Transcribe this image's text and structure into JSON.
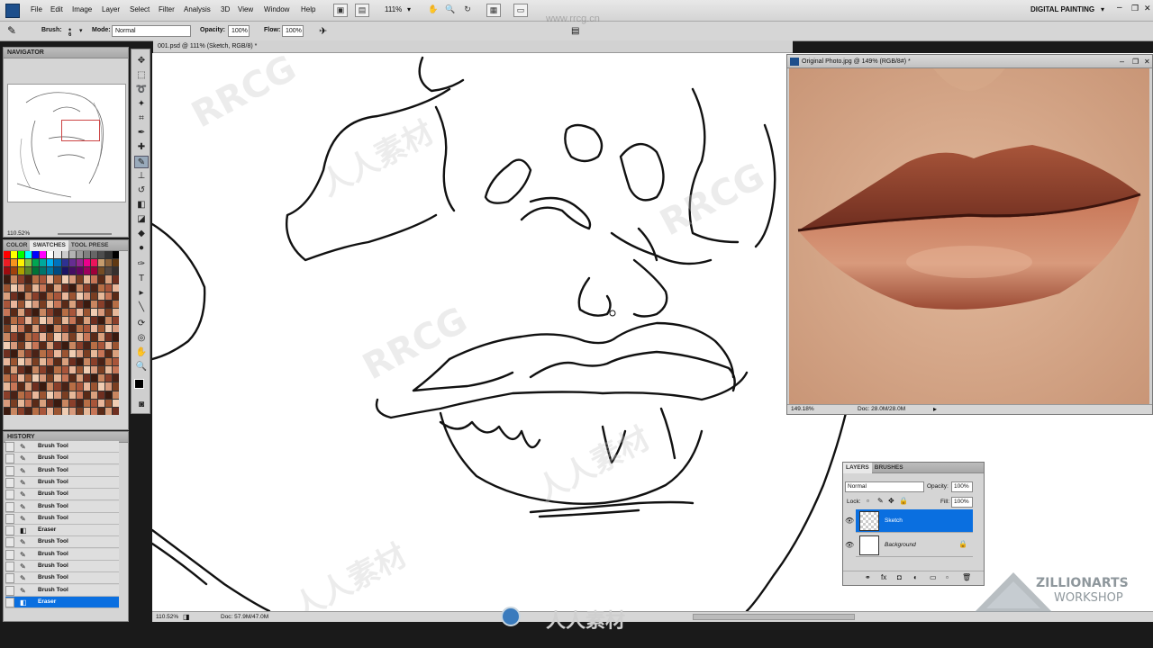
{
  "menubar": {
    "items": [
      "File",
      "Edit",
      "Image",
      "Layer",
      "Select",
      "Filter",
      "Analysis",
      "3D",
      "View",
      "Window",
      "Help"
    ],
    "zoom": "111%",
    "workspace": "DIGITAL PAINTING"
  },
  "options": {
    "brush_label": "Brush:",
    "brush_size": "6",
    "mode_label": "Mode:",
    "mode_value": "Normal",
    "opacity_label": "Opacity:",
    "opacity_value": "100%",
    "flow_label": "Flow:",
    "flow_value": "100%"
  },
  "navigator": {
    "title": "NAVIGATOR",
    "zoom": "110.52%"
  },
  "swatches": {
    "tabs": [
      "COLOR",
      "SWATCHES",
      "TOOL PRESE"
    ],
    "active_tab": "SWATCHES"
  },
  "history": {
    "title": "HISTORY",
    "items": [
      "Brush Tool",
      "Brush Tool",
      "Brush Tool",
      "Brush Tool",
      "Brush Tool",
      "Brush Tool",
      "Brush Tool",
      "Eraser",
      "Brush Tool",
      "Brush Tool",
      "Brush Tool",
      "Brush Tool",
      "Brush Tool",
      "Eraser"
    ],
    "selected_index": 13
  },
  "document": {
    "tab_title": "001.psd @ 111% (Sketch, RGB/8) *",
    "zoom": "110.52%",
    "doc_info": "Doc: 57.9M/47.0M"
  },
  "photo_window": {
    "title": "Original Photo.jpg @ 149% (RGB/8#) *",
    "zoom": "149.18%",
    "doc_info": "Doc: 28.0M/28.0M"
  },
  "layers": {
    "tabs": [
      "LAYERS",
      "BRUSHES"
    ],
    "blend_mode": "Normal",
    "opacity_label": "Opacity:",
    "opacity_value": "100%",
    "lock_label": "Lock:",
    "fill_label": "Fill:",
    "fill_value": "100%",
    "items": [
      {
        "name": "Sketch",
        "selected": true
      },
      {
        "name": "Background",
        "selected": false
      }
    ]
  },
  "branding": {
    "line1": "ZILLIONARTS",
    "line2": "WORKSHOP",
    "watermark": "RRCG",
    "watermark_cn": "人人素材",
    "url": "www.rrcg.cn"
  }
}
